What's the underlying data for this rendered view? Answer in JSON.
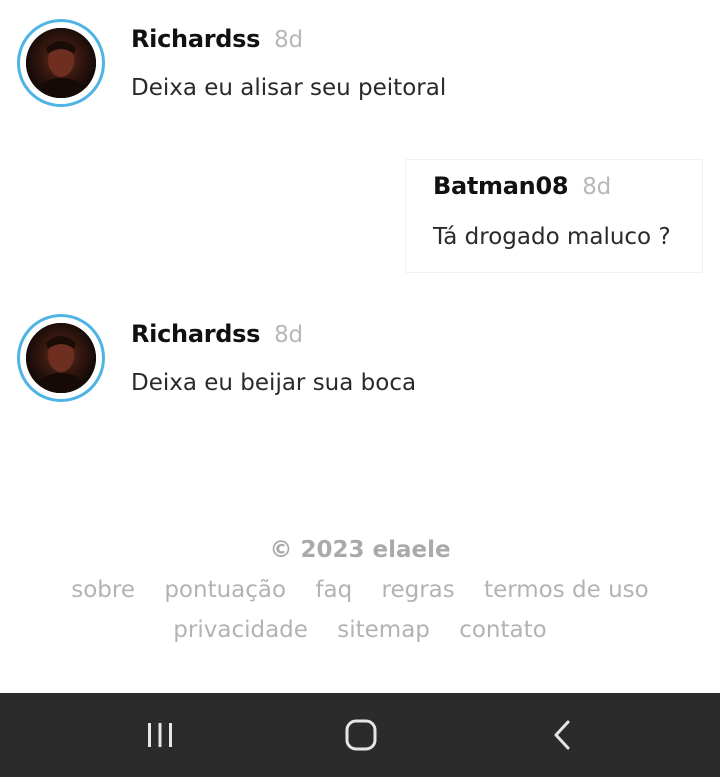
{
  "messages": [
    {
      "author": "Richardss",
      "time": "8d",
      "text": "Deixa eu alisar seu peitoral"
    },
    {
      "author": "Batman08",
      "time": "8d",
      "text": "Tá drogado maluco ?"
    },
    {
      "author": "Richardss",
      "time": "8d",
      "text": "Deixa eu beijar sua boca"
    }
  ],
  "footer": {
    "copyright": "© 2023 elaele",
    "links_row1": [
      "sobre",
      "pontuação",
      "faq",
      "regras",
      "termos de uso"
    ],
    "links_row2": [
      "privacidade",
      "sitemap",
      "contato"
    ]
  },
  "navbar": {
    "icons": [
      "recent-apps-icon",
      "home-icon",
      "back-icon"
    ],
    "background": "#2b2b2b"
  },
  "colors": {
    "avatar_ring": "#4fb3e4",
    "muted_text": "#b3b3b3"
  }
}
